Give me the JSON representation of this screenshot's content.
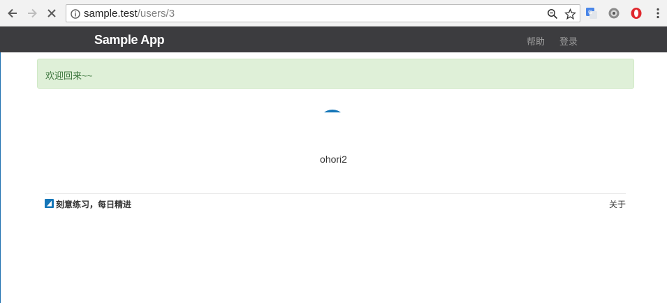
{
  "browser": {
    "url_host": "sample.test",
    "url_path": "/users/3",
    "icons": {
      "back": "back-arrow-icon",
      "forward": "forward-arrow-icon",
      "stop": "stop-loading-icon",
      "info": "site-info-icon",
      "zoom": "zoom-icon",
      "bookmark": "bookmark-star-icon",
      "translate": "translate-extension-icon",
      "ext2": "extension-icon",
      "opera": "opera-extension-icon",
      "menu": "kebab-menu-icon"
    }
  },
  "navbar": {
    "brand": "Sample App",
    "links": [
      "帮助",
      "登录"
    ]
  },
  "flash": {
    "message": "欢迎回来~~",
    "color": "#dff0d8"
  },
  "profile": {
    "username": "ohori2",
    "avatar_color": "#1576b8"
  },
  "footer": {
    "slogan": "刻意练习，每日精进",
    "about": "关于"
  }
}
